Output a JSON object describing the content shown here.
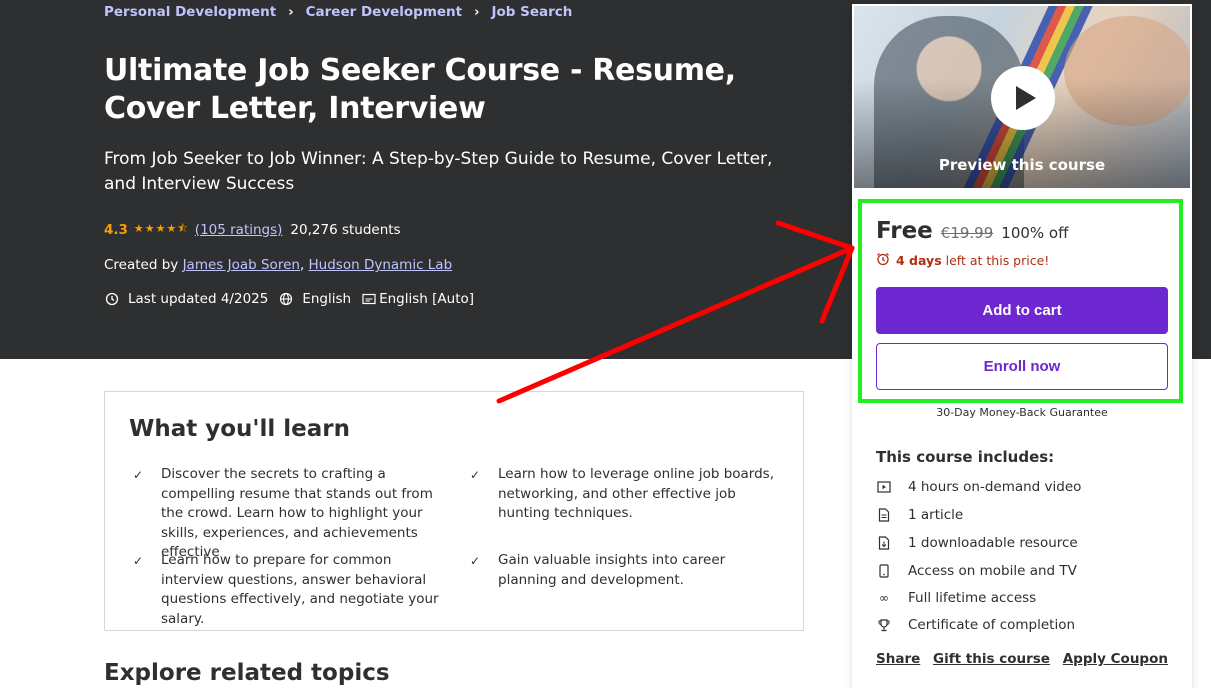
{
  "breadcrumb": [
    "Personal Development",
    "Career Development",
    "Job Search"
  ],
  "course": {
    "title": "Ultimate Job Seeker Course - Resume, Cover Letter, Interview",
    "subtitle": "From Job Seeker to Job Winner: A Step-by-Step Guide to Resume, Cover Letter, and Interview Success",
    "rating": "4.3",
    "rating_value": 4.3,
    "rating_count": "(105 ratings)",
    "students": "20,276 students",
    "created_by_label": "Created by",
    "authors": [
      "James Joab Soren",
      "Hudson Dynamic Lab"
    ],
    "last_updated": "Last updated 4/2025",
    "language": "English",
    "captions": "English [Auto]"
  },
  "learn": {
    "title": "What you'll learn",
    "items": [
      "Discover the secrets to crafting a compelling resume that stands out from the crowd. Learn how to highlight your skills, experiences, and achievements effective",
      "Learn how to leverage online job boards, networking, and other effective job hunting techniques.",
      "Learn how to prepare for common interview questions, answer behavioral questions effectively, and negotiate your salary.",
      "Gain valuable insights into career planning and development."
    ]
  },
  "explore_title": "Explore related topics",
  "sidebar": {
    "preview_label": "Preview this course",
    "price": "Free",
    "original_price": "€19.99",
    "discount": "100% off",
    "timer_days": "4 days",
    "timer_rest": "left at this price!",
    "add_to_cart": "Add to cart",
    "enroll_now": "Enroll now",
    "guarantee": "30-Day Money-Back Guarantee",
    "includes_title": "This course includes:",
    "includes": [
      {
        "icon": "video-icon",
        "label": "4 hours on-demand video"
      },
      {
        "icon": "article-icon",
        "label": "1 article"
      },
      {
        "icon": "download-file-icon",
        "label": "1 downloadable resource"
      },
      {
        "icon": "mobile-icon",
        "label": "Access on mobile and TV"
      },
      {
        "icon": "infinity-icon",
        "label": "Full lifetime access"
      },
      {
        "icon": "trophy-icon",
        "label": "Certificate of completion"
      }
    ],
    "links": [
      "Share",
      "Gift this course",
      "Apply Coupon"
    ]
  },
  "colors": {
    "hero_bg": "#2d2f31",
    "link_purple": "#c0c4fc",
    "star_orange": "#f69c08",
    "cta_purple": "#6d28d2",
    "timer_red": "#b32d0f",
    "highlight_green": "#22ee22",
    "annotation_red": "#ff0000"
  }
}
